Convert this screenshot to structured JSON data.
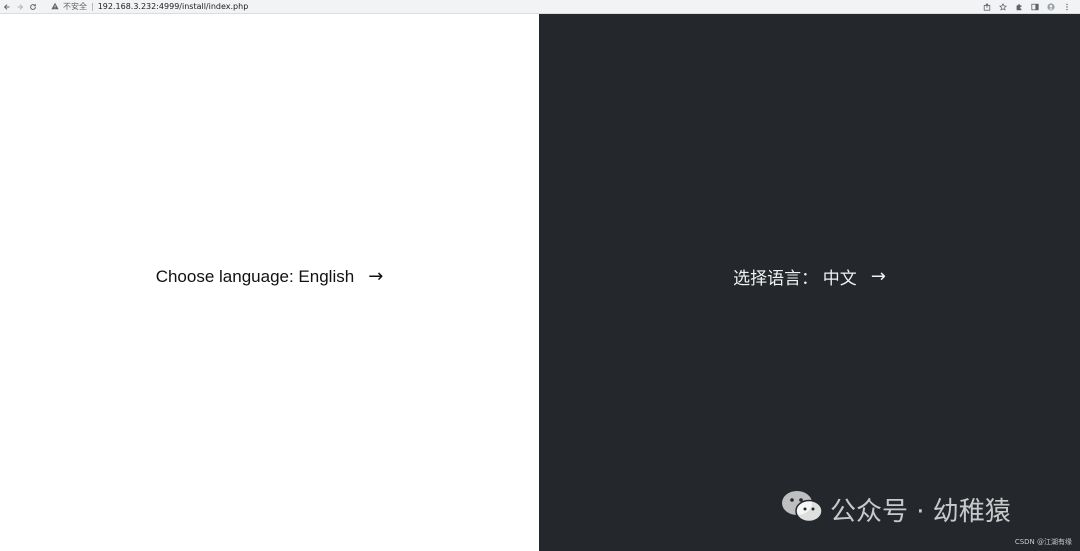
{
  "browser": {
    "security_label": "不安全",
    "separator": "|",
    "url": "192.168.3.232:4999/install/index.php"
  },
  "left_panel": {
    "label": "Choose language: English",
    "arrow": "→",
    "background": "#ffffff"
  },
  "right_panel": {
    "label": "选择语言： 中文",
    "arrow": "→",
    "background": "#24282c"
  },
  "watermark": {
    "text": "公众号 · 幼稚猿",
    "icon": "wechat-icon"
  },
  "footer_mark": "CSDN @江湖有缘"
}
